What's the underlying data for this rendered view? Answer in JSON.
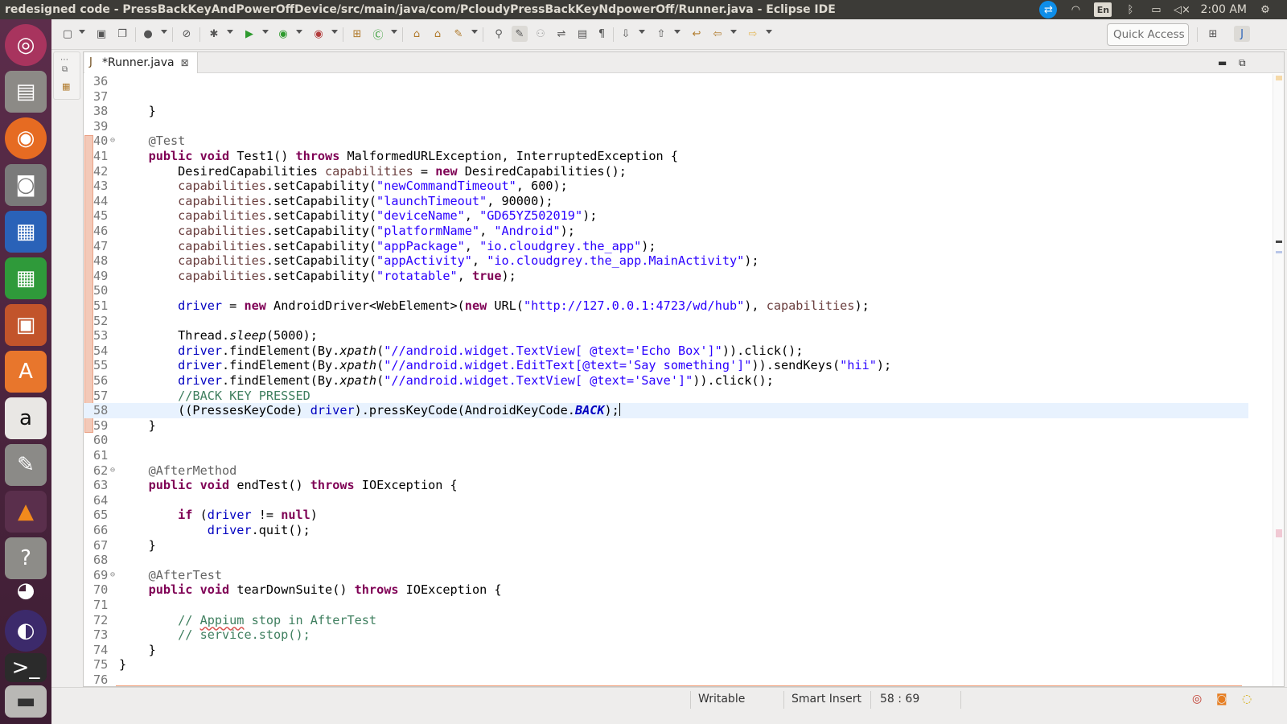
{
  "window": {
    "title": "redesigned code - PressBackKeyAndPowerOffDevice/src/main/java/com/PcloudyPressBackKeyNdpowerOff/Runner.java - Eclipse IDE"
  },
  "tray": {
    "keyboard_layout": "En",
    "clock": "2:00 AM",
    "icons": [
      "teamviewer-icon",
      "wifi-icon",
      "bluetooth-icon",
      "battery-icon",
      "volume-mute-icon",
      "power-icon"
    ]
  },
  "launcher": {
    "items": [
      "ubuntu-dash-icon",
      "files-icon",
      "firefox-icon",
      "camera-icon",
      "writer-icon",
      "calc-icon",
      "impress-icon",
      "software-center-icon",
      "amazon-icon",
      "settings-icon",
      "vlc-icon",
      "help-icon",
      "chrome-icon",
      "eclipse-icon",
      "terminal-icon",
      "disks-icon"
    ]
  },
  "toolbar": {
    "quick_access_placeholder": "Quick Access"
  },
  "editor": {
    "tab_label": "*Runner.java",
    "cursor_line": 58
  },
  "statusbar": {
    "writable": "Writable",
    "insert_mode": "Smart Insert",
    "position": "58 : 69"
  },
  "code": {
    "lines": [
      {
        "n": "36",
        "t": []
      },
      {
        "n": "37",
        "t": []
      },
      {
        "n": "38",
        "t": [
          [
            "",
            "    }"
          ]
        ]
      },
      {
        "n": "39",
        "t": []
      },
      {
        "n": "40",
        "fold": true,
        "t": [
          [
            "",
            "    "
          ],
          [
            "a",
            "@Test"
          ]
        ]
      },
      {
        "n": "41",
        "t": [
          [
            "",
            "    "
          ],
          [
            "k",
            "public"
          ],
          [
            "",
            " "
          ],
          [
            "k",
            "void"
          ],
          [
            "",
            " Test1() "
          ],
          [
            "k",
            "throws"
          ],
          [
            "",
            " MalformedURLException, InterruptedException {"
          ]
        ]
      },
      {
        "n": "42",
        "t": [
          [
            "",
            "        DesiredCapabilities "
          ],
          [
            "v",
            "capabilities"
          ],
          [
            "",
            " = "
          ],
          [
            "k",
            "new"
          ],
          [
            "",
            " DesiredCapabilities();"
          ]
        ]
      },
      {
        "n": "43",
        "t": [
          [
            "",
            "        "
          ],
          [
            "v",
            "capabilities"
          ],
          [
            "",
            ".setCapability("
          ],
          [
            "s",
            "\"newCommandTimeout\""
          ],
          [
            "",
            ", 600);"
          ]
        ]
      },
      {
        "n": "44",
        "t": [
          [
            "",
            "        "
          ],
          [
            "v",
            "capabilities"
          ],
          [
            "",
            ".setCapability("
          ],
          [
            "s",
            "\"launchTimeout\""
          ],
          [
            "",
            ", 90000);"
          ]
        ]
      },
      {
        "n": "45",
        "t": [
          [
            "",
            "        "
          ],
          [
            "v",
            "capabilities"
          ],
          [
            "",
            ".setCapability("
          ],
          [
            "s",
            "\"deviceName\""
          ],
          [
            "",
            ", "
          ],
          [
            "s",
            "\"GD65YZ502019\""
          ],
          [
            "",
            ");"
          ]
        ]
      },
      {
        "n": "46",
        "t": [
          [
            "",
            "        "
          ],
          [
            "v",
            "capabilities"
          ],
          [
            "",
            ".setCapability("
          ],
          [
            "s",
            "\"platformName\""
          ],
          [
            "",
            ", "
          ],
          [
            "s",
            "\"Android\""
          ],
          [
            "",
            ");"
          ]
        ]
      },
      {
        "n": "47",
        "t": [
          [
            "",
            "        "
          ],
          [
            "v",
            "capabilities"
          ],
          [
            "",
            ".setCapability("
          ],
          [
            "s",
            "\"appPackage\""
          ],
          [
            "",
            ", "
          ],
          [
            "s",
            "\"io.cloudgrey.the_app\""
          ],
          [
            "",
            ");"
          ]
        ]
      },
      {
        "n": "48",
        "t": [
          [
            "",
            "        "
          ],
          [
            "v",
            "capabilities"
          ],
          [
            "",
            ".setCapability("
          ],
          [
            "s",
            "\"appActivity\""
          ],
          [
            "",
            ", "
          ],
          [
            "s",
            "\"io.cloudgrey.the_app.MainActivity\""
          ],
          [
            "",
            ");"
          ]
        ]
      },
      {
        "n": "49",
        "t": [
          [
            "",
            "        "
          ],
          [
            "v",
            "capabilities"
          ],
          [
            "",
            ".setCapability("
          ],
          [
            "s",
            "\"rotatable\""
          ],
          [
            "",
            ", "
          ],
          [
            "k",
            "true"
          ],
          [
            "",
            ");"
          ]
        ]
      },
      {
        "n": "50",
        "t": []
      },
      {
        "n": "51",
        "t": [
          [
            "",
            "        "
          ],
          [
            "f",
            "driver"
          ],
          [
            "",
            " = "
          ],
          [
            "k",
            "new"
          ],
          [
            "",
            " AndroidDriver<WebElement>("
          ],
          [
            "k",
            "new"
          ],
          [
            "",
            " URL("
          ],
          [
            "s",
            "\"http://127.0.0.1:4723/wd/hub\""
          ],
          [
            "",
            "), "
          ],
          [
            "v",
            "capabilities"
          ],
          [
            "",
            ");"
          ]
        ]
      },
      {
        "n": "52",
        "t": []
      },
      {
        "n": "53",
        "t": [
          [
            "",
            "        Thread."
          ],
          [
            "st",
            "sleep"
          ],
          [
            "",
            "(5000);"
          ]
        ]
      },
      {
        "n": "54",
        "t": [
          [
            "",
            "        "
          ],
          [
            "f",
            "driver"
          ],
          [
            "",
            ".findElement(By."
          ],
          [
            "st",
            "xpath"
          ],
          [
            "",
            "("
          ],
          [
            "s",
            "\"//android.widget.TextView[ @text='Echo Box']\""
          ],
          [
            "",
            ")).click();"
          ]
        ]
      },
      {
        "n": "55",
        "t": [
          [
            "",
            "        "
          ],
          [
            "f",
            "driver"
          ],
          [
            "",
            ".findElement(By."
          ],
          [
            "st",
            "xpath"
          ],
          [
            "",
            "("
          ],
          [
            "s",
            "\"//android.widget.EditText[@text='Say something']\""
          ],
          [
            "",
            ")).sendKeys("
          ],
          [
            "s",
            "\"hii\""
          ],
          [
            "",
            ");"
          ]
        ]
      },
      {
        "n": "56",
        "t": [
          [
            "",
            "        "
          ],
          [
            "f",
            "driver"
          ],
          [
            "",
            ".findElement(By."
          ],
          [
            "st",
            "xpath"
          ],
          [
            "",
            "("
          ],
          [
            "s",
            "\"//android.widget.TextView[ @text='Save']\""
          ],
          [
            "",
            ")).click();"
          ]
        ]
      },
      {
        "n": "57",
        "t": [
          [
            "",
            "        "
          ],
          [
            "c",
            "//BACK KEY PRESSED"
          ]
        ]
      },
      {
        "n": "58",
        "current": true,
        "t": [
          [
            "",
            "        ((PressesKeyCode) "
          ],
          [
            "f",
            "driver"
          ],
          [
            "",
            ").pressKeyCode(AndroidKeyCode."
          ],
          [
            "cst",
            "BACK"
          ],
          [
            "",
            ");"
          ]
        ]
      },
      {
        "n": "59",
        "t": [
          [
            "",
            "    }"
          ]
        ]
      },
      {
        "n": "60",
        "t": []
      },
      {
        "n": "61",
        "t": []
      },
      {
        "n": "62",
        "fold": true,
        "t": [
          [
            "",
            "    "
          ],
          [
            "a",
            "@AfterMethod"
          ]
        ]
      },
      {
        "n": "63",
        "t": [
          [
            "",
            "    "
          ],
          [
            "k",
            "public"
          ],
          [
            "",
            " "
          ],
          [
            "k",
            "void"
          ],
          [
            "",
            " endTest() "
          ],
          [
            "k",
            "throws"
          ],
          [
            "",
            " IOException {"
          ]
        ]
      },
      {
        "n": "64",
        "t": []
      },
      {
        "n": "65",
        "t": [
          [
            "",
            "        "
          ],
          [
            "k",
            "if"
          ],
          [
            "",
            " ("
          ],
          [
            "f",
            "driver"
          ],
          [
            "",
            " != "
          ],
          [
            "k",
            "null"
          ],
          [
            "",
            ")"
          ]
        ]
      },
      {
        "n": "66",
        "t": [
          [
            "",
            "            "
          ],
          [
            "f",
            "driver"
          ],
          [
            "",
            ".quit();"
          ]
        ]
      },
      {
        "n": "67",
        "t": [
          [
            "",
            "    }"
          ]
        ]
      },
      {
        "n": "68",
        "t": []
      },
      {
        "n": "69",
        "fold": true,
        "t": [
          [
            "",
            "    "
          ],
          [
            "a",
            "@AfterTest"
          ]
        ]
      },
      {
        "n": "70",
        "t": [
          [
            "",
            "    "
          ],
          [
            "k",
            "public"
          ],
          [
            "",
            " "
          ],
          [
            "k",
            "void"
          ],
          [
            "",
            " tearDownSuite() "
          ],
          [
            "k",
            "throws"
          ],
          [
            "",
            " IOException {"
          ]
        ]
      },
      {
        "n": "71",
        "t": []
      },
      {
        "n": "72",
        "t": [
          [
            "",
            "        "
          ],
          [
            "c",
            "// "
          ],
          [
            "cw",
            "Appium"
          ],
          [
            "c",
            " stop in AfterTest"
          ]
        ]
      },
      {
        "n": "73",
        "t": [
          [
            "",
            "        "
          ],
          [
            "c",
            "// service.stop();"
          ]
        ]
      },
      {
        "n": "74",
        "t": [
          [
            "",
            "    }"
          ]
        ]
      },
      {
        "n": "75",
        "t": [
          [
            "",
            "}"
          ]
        ]
      },
      {
        "n": "76",
        "t": []
      }
    ]
  }
}
